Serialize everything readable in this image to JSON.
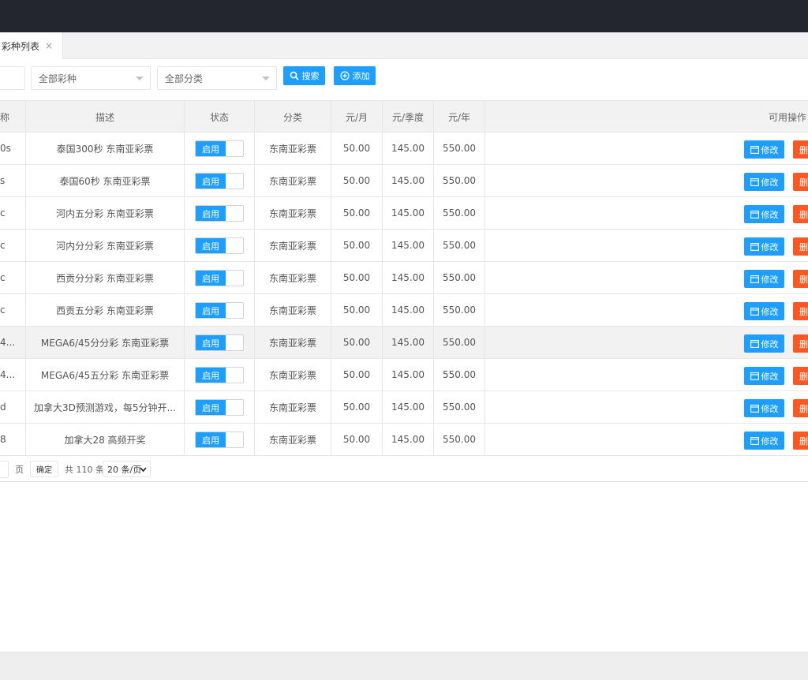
{
  "tab": {
    "label": "彩种列表",
    "close": "×"
  },
  "filters": {
    "lottery_select": "全部彩种",
    "category_select": "全部分类",
    "search_button": "搜索",
    "add_button": "添加"
  },
  "table": {
    "columns": {
      "name": "称",
      "desc": "描述",
      "status": "状态",
      "category": "分类",
      "month": "元/月",
      "quarter": "元/季度",
      "year": "元/年",
      "ops": "可用操作"
    },
    "rows": [
      {
        "name": "0s",
        "desc": "泰国300秒 东南亚彩票",
        "status": "启用",
        "category": "东南亚彩票",
        "month": "50.00",
        "quarter": "145.00",
        "year": "550.00",
        "edit": "修改",
        "delete": "删除"
      },
      {
        "name": "s",
        "desc": "泰国60秒 东南亚彩票",
        "status": "启用",
        "category": "东南亚彩票",
        "month": "50.00",
        "quarter": "145.00",
        "year": "550.00",
        "edit": "修改",
        "delete": "删除"
      },
      {
        "name": "c",
        "desc": "河内五分彩 东南亚彩票",
        "status": "启用",
        "category": "东南亚彩票",
        "month": "50.00",
        "quarter": "145.00",
        "year": "550.00",
        "edit": "修改",
        "delete": "删除"
      },
      {
        "name": "c",
        "desc": "河内分分彩 东南亚彩票",
        "status": "启用",
        "category": "东南亚彩票",
        "month": "50.00",
        "quarter": "145.00",
        "year": "550.00",
        "edit": "修改",
        "delete": "删除"
      },
      {
        "name": "c",
        "desc": "西贡分分彩 东南亚彩票",
        "status": "启用",
        "category": "东南亚彩票",
        "month": "50.00",
        "quarter": "145.00",
        "year": "550.00",
        "edit": "修改",
        "delete": "删除"
      },
      {
        "name": "c",
        "desc": "西贡五分彩 东南亚彩票",
        "status": "启用",
        "category": "东南亚彩票",
        "month": "50.00",
        "quarter": "145.00",
        "year": "550.00",
        "edit": "修改",
        "delete": "删除"
      },
      {
        "name": "4...",
        "desc": "MEGA6/45分分彩 东南亚彩票",
        "status": "启用",
        "category": "东南亚彩票",
        "month": "50.00",
        "quarter": "145.00",
        "year": "550.00",
        "edit": "修改",
        "delete": "删除"
      },
      {
        "name": "4...",
        "desc": "MEGA6/45五分彩 东南亚彩票",
        "status": "启用",
        "category": "东南亚彩票",
        "month": "50.00",
        "quarter": "145.00",
        "year": "550.00",
        "edit": "修改",
        "delete": "删除"
      },
      {
        "name": "d",
        "desc": "加拿大3D预测游戏，每5分钟开...",
        "status": "启用",
        "category": "东南亚彩票",
        "month": "50.00",
        "quarter": "145.00",
        "year": "550.00",
        "edit": "修改",
        "delete": "删除"
      },
      {
        "name": "8",
        "desc": "加拿大28 高频开奖",
        "status": "启用",
        "category": "东南亚彩票",
        "month": "50.00",
        "quarter": "145.00",
        "year": "550.00",
        "edit": "修改",
        "delete": "删除"
      }
    ]
  },
  "pagination": {
    "page_unit": "页",
    "confirm": "确定",
    "total": "共 110 条",
    "page_size": "20 条/页"
  }
}
